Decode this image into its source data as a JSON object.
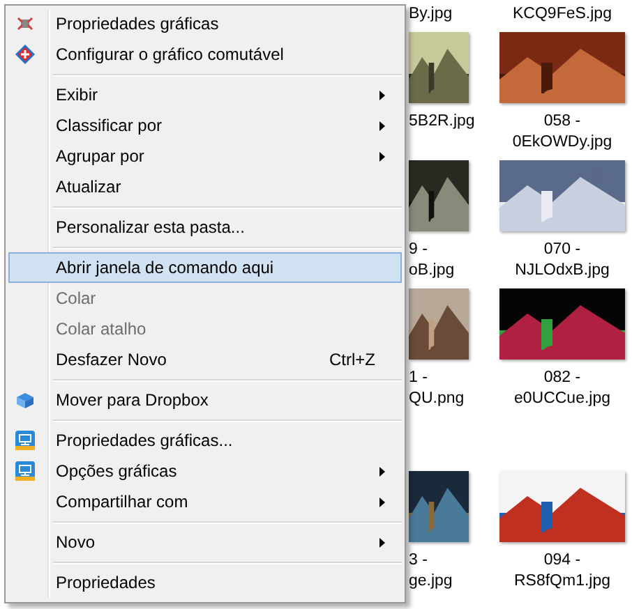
{
  "file_grid": {
    "rows": [
      {
        "tiles": [
          {
            "kind": "caption",
            "lines": [
              "By.jpg"
            ]
          },
          {
            "kind": "caption",
            "lines": [
              "KCQ9FeS.jpg"
            ]
          }
        ]
      },
      {
        "tiles": [
          {
            "kind": "picture",
            "lines": [
              "5B2R.jpg"
            ]
          },
          {
            "kind": "picture",
            "lines": [
              "058 -",
              "0EkOWDy.jpg"
            ]
          }
        ]
      },
      {
        "tiles": [
          {
            "kind": "picture",
            "lines": [
              "9 -",
              "oB.jpg"
            ]
          },
          {
            "kind": "picture",
            "lines": [
              "070 -",
              "NJLOdxB.jpg"
            ]
          }
        ]
      },
      {
        "tiles": [
          {
            "kind": "picture",
            "lines": [
              "1 -",
              "QU.png"
            ]
          },
          {
            "kind": "picture",
            "lines": [
              "082 -",
              "e0UCCue.jpg"
            ]
          }
        ]
      },
      {
        "tiles": [
          {
            "kind": "picture",
            "lines": [
              "3 -",
              "ge.jpg"
            ]
          },
          {
            "kind": "picture",
            "lines": [
              "094 -",
              "RS8fQm1.jpg"
            ]
          }
        ]
      }
    ]
  },
  "context_menu": {
    "items": [
      {
        "kind": "chip",
        "label": "Propriedades gráficas",
        "submenu": false,
        "disabled": false,
        "selected": false
      },
      {
        "kind": "diamond",
        "label": "Configurar o gráfico comutável",
        "submenu": false,
        "disabled": false,
        "selected": false
      },
      {
        "kind": "separator"
      },
      {
        "kind": "plain",
        "label": "Exibir",
        "submenu": true,
        "disabled": false,
        "selected": false
      },
      {
        "kind": "plain",
        "label": "Classificar por",
        "submenu": true,
        "disabled": false,
        "selected": false
      },
      {
        "kind": "plain",
        "label": "Agrupar por",
        "submenu": true,
        "disabled": false,
        "selected": false
      },
      {
        "kind": "plain",
        "label": "Atualizar",
        "submenu": false,
        "disabled": false,
        "selected": false
      },
      {
        "kind": "separator"
      },
      {
        "kind": "plain",
        "label": "Personalizar esta pasta...",
        "submenu": false,
        "disabled": false,
        "selected": false
      },
      {
        "kind": "separator"
      },
      {
        "kind": "plain",
        "label": "Abrir janela de comando aqui",
        "submenu": false,
        "disabled": false,
        "selected": true
      },
      {
        "kind": "plain",
        "label": "Colar",
        "submenu": false,
        "disabled": true,
        "selected": false
      },
      {
        "kind": "plain",
        "label": "Colar atalho",
        "submenu": false,
        "disabled": true,
        "selected": false
      },
      {
        "kind": "plain",
        "label": "Desfazer Novo",
        "shortcut": "Ctrl+Z",
        "submenu": false,
        "disabled": false,
        "selected": false
      },
      {
        "kind": "separator"
      },
      {
        "kind": "box",
        "label": "Mover para Dropbox",
        "submenu": false,
        "disabled": false,
        "selected": false
      },
      {
        "kind": "separator"
      },
      {
        "kind": "monitor",
        "label": "Propriedades gráficas...",
        "submenu": false,
        "disabled": false,
        "selected": false
      },
      {
        "kind": "monitor",
        "label": "Opções gráficas",
        "submenu": true,
        "disabled": false,
        "selected": false
      },
      {
        "kind": "plain",
        "label": "Compartilhar com",
        "submenu": true,
        "disabled": false,
        "selected": false
      },
      {
        "kind": "separator"
      },
      {
        "kind": "plain",
        "label": "Novo",
        "submenu": true,
        "disabled": false,
        "selected": false
      },
      {
        "kind": "separator"
      },
      {
        "kind": "plain",
        "label": "Propriedades",
        "submenu": false,
        "disabled": false,
        "selected": false
      }
    ]
  }
}
